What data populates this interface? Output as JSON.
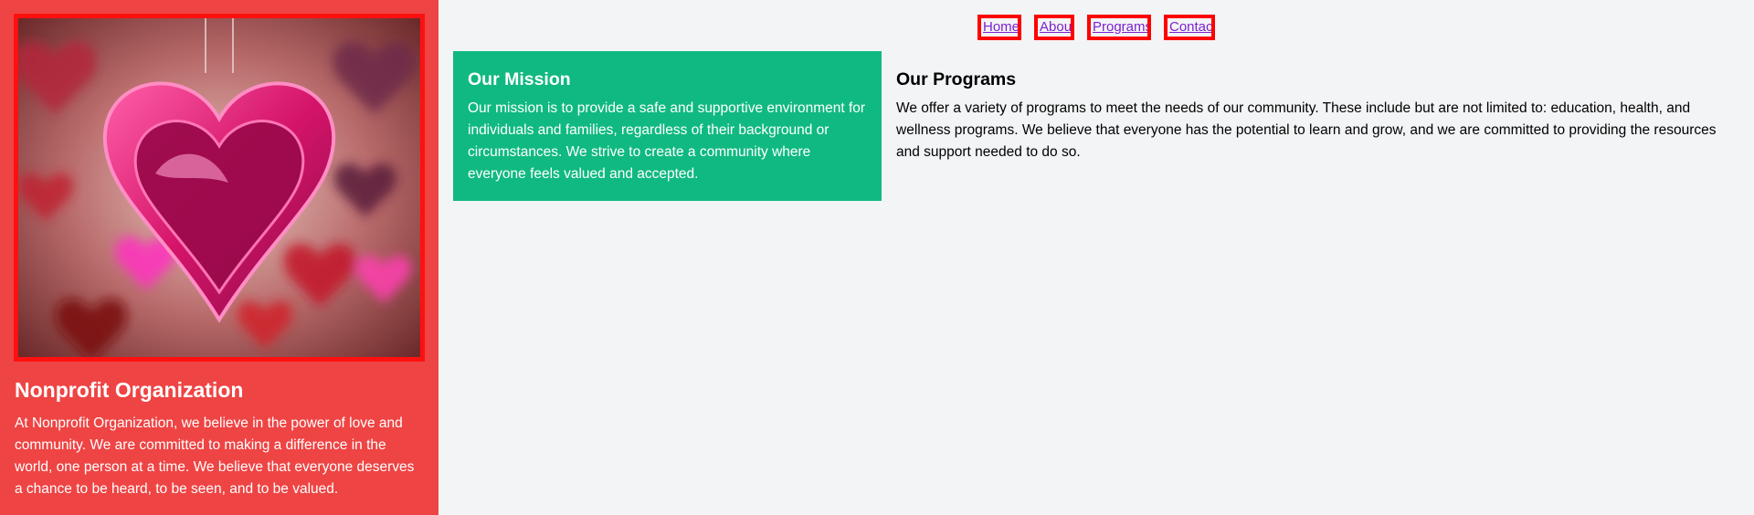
{
  "sidebar": {
    "image_alt": "hanging-heart-decoration",
    "title": "Nonprofit Organization",
    "text": "At Nonprofit Organization, we believe in the power of love and community. We are committed to making a difference in the world, one person at a time. We believe that everyone deserves a chance to be heard, to be seen, and to be valued.",
    "background_color": "#ef4444"
  },
  "nav": {
    "items": [
      {
        "label": "Home"
      },
      {
        "label": "About"
      },
      {
        "label": "Programs"
      },
      {
        "label": "Contact"
      }
    ]
  },
  "mission": {
    "title": "Our Mission",
    "text": "Our mission is to provide a safe and supportive environment for individuals and families, regardless of their background or circumstances. We strive to create a community where everyone feels valued and accepted.",
    "background_color": "#10b981"
  },
  "programs": {
    "title": "Our Programs",
    "text": "We offer a variety of programs to meet the needs of our community. These include but are not limited to: education, health, and wellness programs. We believe that everyone has the potential to learn and grow, and we are committed to providing the resources and support needed to do so."
  }
}
